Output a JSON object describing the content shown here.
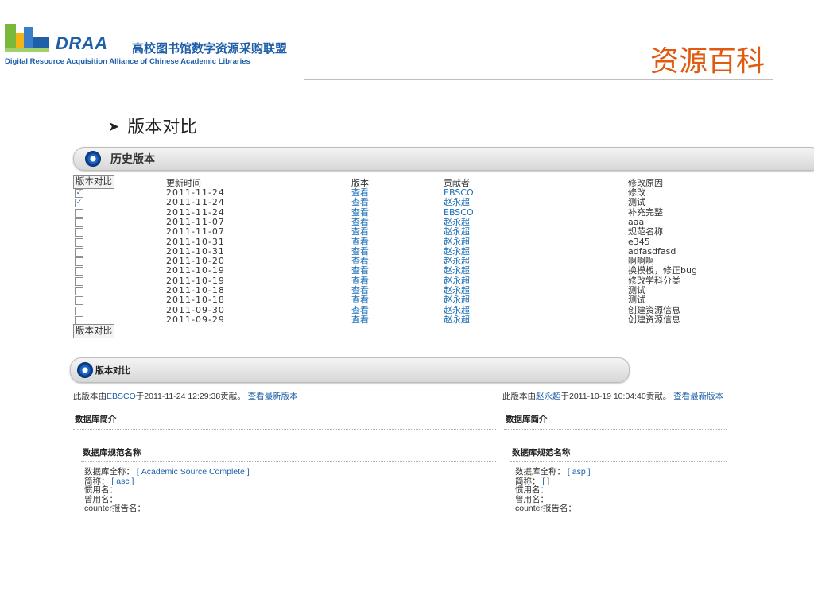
{
  "header": {
    "brand": "DRAA",
    "brand_cn": "高校图书馆数字资源采购联盟",
    "brand_en": "Digital Resource Acquisition Alliance of Chinese Academic Libraries",
    "slide_title": "资源百科",
    "bullet": "版本对比",
    "colors": {
      "brand_blue": "#1f5fa8",
      "title_orange": "#e05b10",
      "logo_green": "#79b83a",
      "logo_yellow": "#f3b415"
    }
  },
  "history": {
    "panel_title": "历史版本",
    "compare_button": "版本对比",
    "columns": {
      "time": "更新时间",
      "version": "版本",
      "contributor": "贡献者",
      "reason": "修改原因"
    },
    "rows": [
      {
        "checked": true,
        "date": "2011-11-24",
        "version": "查看",
        "contributor": "EBSCO",
        "reason": "修改"
      },
      {
        "checked": true,
        "date": "2011-11-24",
        "version": "查看",
        "contributor": "赵永超",
        "reason": "测试"
      },
      {
        "checked": false,
        "date": "2011-11-24",
        "version": "查看",
        "contributor": "EBSCO",
        "reason": "补充完整"
      },
      {
        "checked": false,
        "date": "2011-11-07",
        "version": "查看",
        "contributor": "赵永超",
        "reason": "aaa"
      },
      {
        "checked": false,
        "date": "2011-11-07",
        "version": "查看",
        "contributor": "赵永超",
        "reason": "规范名称"
      },
      {
        "checked": false,
        "date": "2011-10-31",
        "version": "查看",
        "contributor": "赵永超",
        "reason": "e345"
      },
      {
        "checked": false,
        "date": "2011-10-31",
        "version": "查看",
        "contributor": "赵永超",
        "reason": "adfasdfasd"
      },
      {
        "checked": false,
        "date": "2011-10-20",
        "version": "查看",
        "contributor": "赵永超",
        "reason": "啊啊啊"
      },
      {
        "checked": false,
        "date": "2011-10-19",
        "version": "查看",
        "contributor": "赵永超",
        "reason": "换模板，修正bug"
      },
      {
        "checked": false,
        "date": "2011-10-19",
        "version": "查看",
        "contributor": "赵永超",
        "reason": "修改学科分类"
      },
      {
        "checked": false,
        "date": "2011-10-18",
        "version": "查看",
        "contributor": "赵永超",
        "reason": "测试"
      },
      {
        "checked": false,
        "date": "2011-10-18",
        "version": "查看",
        "contributor": "赵永超",
        "reason": "测试"
      },
      {
        "checked": false,
        "date": "2011-09-30",
        "version": "查看",
        "contributor": "赵永超",
        "reason": "创建资源信息"
      },
      {
        "checked": false,
        "date": "2011-09-29",
        "version": "查看",
        "contributor": "赵永超",
        "reason": "创建资源信息"
      }
    ]
  },
  "compare": {
    "panel_title": "版本对比",
    "left": {
      "info_pre": "此版本由",
      "author": "EBSCO",
      "info_mid": "于2011-11-24 12:29:38贡献。",
      "latest_link": "查看最新版本",
      "section": "数据库简介",
      "subsection": "数据库规范名称",
      "fields": [
        {
          "label": "数据库全称：",
          "value": "[ Academic Source Complete ]"
        },
        {
          "label": "简称：",
          "value": "[ asc ]"
        },
        {
          "label": "惯用名：",
          "value": ""
        },
        {
          "label": "曾用名：",
          "value": ""
        },
        {
          "label": "counter报告名：",
          "value": ""
        }
      ]
    },
    "right": {
      "info_pre": "此版本由",
      "author": "赵永超",
      "info_mid": "于2011-10-19 10:04:40贡献。",
      "latest_link": "查看最新版本",
      "section": "数据库简介",
      "subsection": "数据库规范名称",
      "fields": [
        {
          "label": "数据库全称：",
          "value": "[ asp ]"
        },
        {
          "label": "简称：",
          "value": "[ ]"
        },
        {
          "label": "惯用名：",
          "value": ""
        },
        {
          "label": "曾用名：",
          "value": ""
        },
        {
          "label": "counter报告名：",
          "value": ""
        }
      ]
    }
  }
}
